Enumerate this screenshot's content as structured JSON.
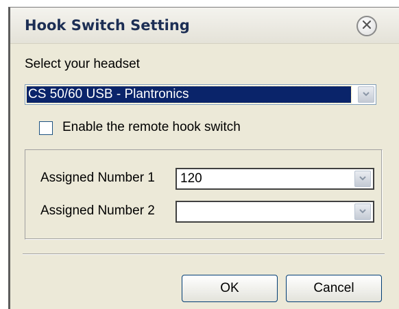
{
  "dialog": {
    "title": "Hook Switch Setting",
    "close_icon": "close-icon"
  },
  "headset": {
    "label": "Select your headset",
    "selected": "CS 50/60 USB - Plantronics"
  },
  "remote_hook": {
    "label": "Enable the remote hook switch",
    "checked": false
  },
  "assigned": [
    {
      "label": "Assigned Number 1",
      "value": "120"
    },
    {
      "label": "Assigned Number 2",
      "value": ""
    }
  ],
  "buttons": {
    "ok": "OK",
    "cancel": "Cancel"
  },
  "colors": {
    "dialog_bg": "#ece9d8",
    "title_text": "#1c2e54",
    "selection_bg": "#0a246a"
  }
}
